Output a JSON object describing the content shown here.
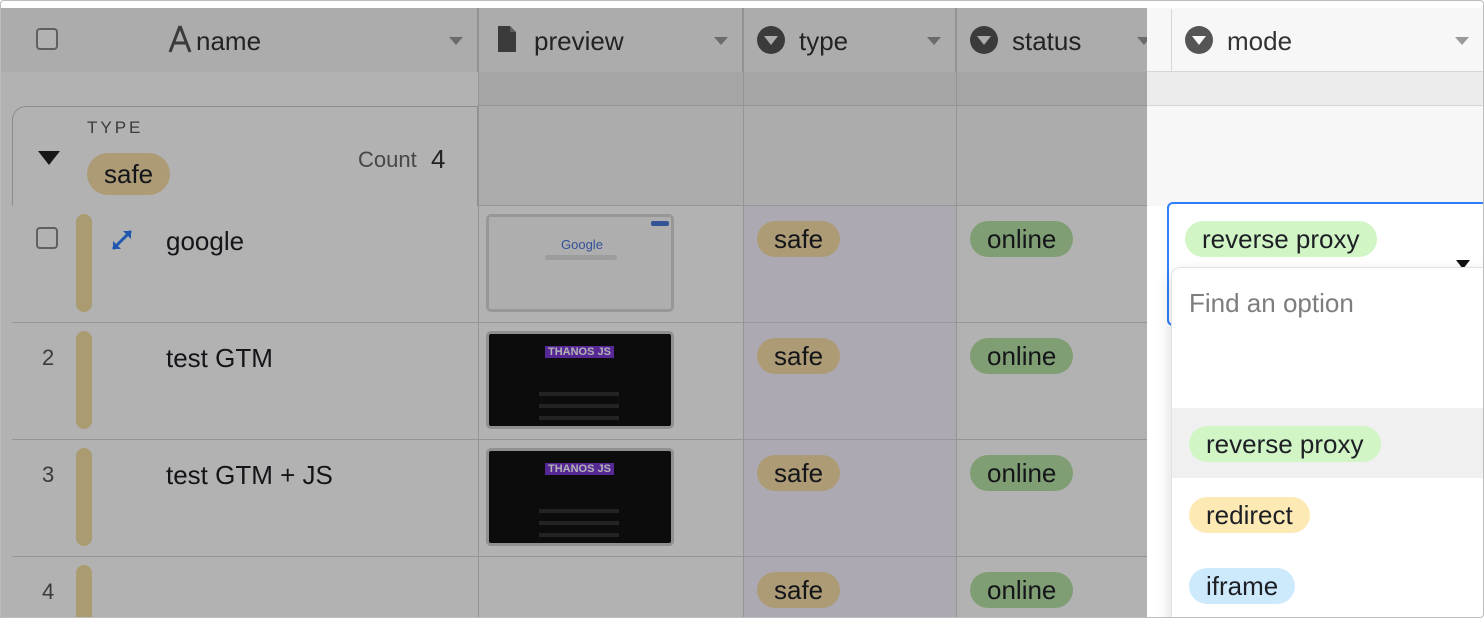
{
  "columns": [
    {
      "label": "name",
      "icon": "text-field-icon"
    },
    {
      "label": "preview",
      "icon": "document-icon"
    },
    {
      "label": "type",
      "icon": "single-select-icon"
    },
    {
      "label": "status",
      "icon": "single-select-icon"
    },
    {
      "label": "mode",
      "icon": "single-select-icon"
    }
  ],
  "group": {
    "field_label": "TYPE",
    "value": "safe",
    "count_label": "Count",
    "count": "4"
  },
  "rows": [
    {
      "num": "",
      "name": "google",
      "preview": "Google",
      "type": "safe",
      "status": "online",
      "mode": "reverse proxy"
    },
    {
      "num": "2",
      "name": "test GTM",
      "preview": "THANOS JS",
      "type": "safe",
      "status": "online",
      "mode": ""
    },
    {
      "num": "3",
      "name": "test GTM + JS",
      "preview": "THANOS JS",
      "type": "safe",
      "status": "online",
      "mode": ""
    },
    {
      "num": "4",
      "name": "",
      "preview": "",
      "type": "safe",
      "status": "online",
      "mode": ""
    }
  ],
  "dropdown": {
    "search_placeholder": "Find an option",
    "options": [
      "reverse proxy",
      "redirect",
      "iframe"
    ]
  },
  "colors": {
    "safe": "#f6dea8",
    "online": "#b6e3a5",
    "reverse_proxy": "#d1f5c5",
    "redirect": "#fde9b3",
    "iframe": "#cdeafd",
    "focus_blue": "#2d7ff9"
  }
}
